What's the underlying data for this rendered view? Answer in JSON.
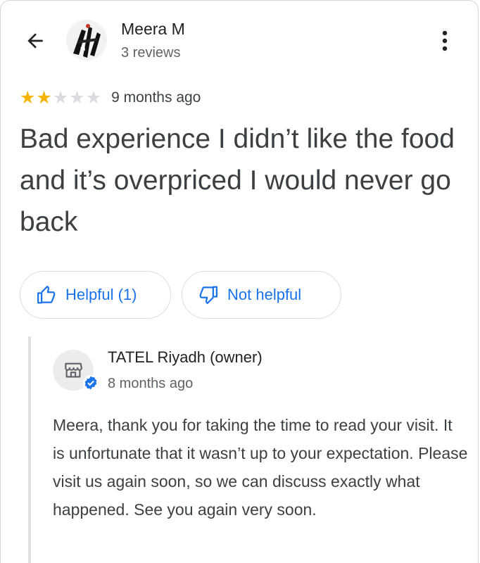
{
  "header": {
    "back_icon": "arrow-left-icon",
    "more_icon": "more-vertical-icon"
  },
  "reviewer": {
    "name": "Meera M",
    "meta": "3 reviews"
  },
  "review": {
    "rating": 2,
    "max_rating": 5,
    "stars": [
      "★",
      "★",
      "★",
      "★",
      "★"
    ],
    "date": "9 months ago",
    "text": "Bad experience I didn’t like the food and it’s overpriced I would never go back"
  },
  "actions": {
    "helpful_label": "Helpful (1)",
    "not_helpful_label": "Not helpful"
  },
  "owner": {
    "name": "TATEL Riyadh (owner)",
    "date": "8 months ago",
    "reply": "Meera, thank you for taking the time to read your visit. It is unfortunate that it wasn’t up to your expectation. Please visit us again soon, so we can discuss exactly what happened. See you again very soon."
  },
  "colors": {
    "accent": "#1a73e8",
    "star_on": "#f4b400",
    "star_off": "#dadce0"
  }
}
